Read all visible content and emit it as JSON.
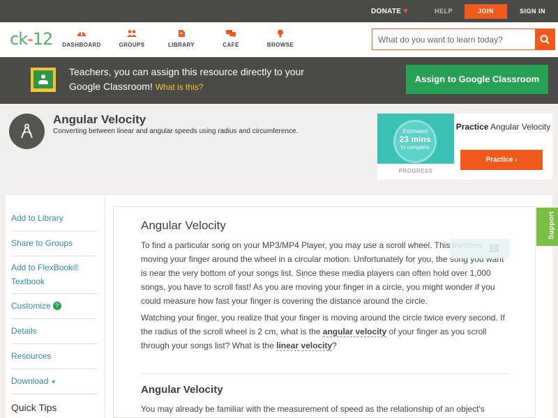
{
  "topbar": {
    "donate": "DONATE",
    "help": "HELP",
    "join": "JOIN",
    "signin": "SIGN IN"
  },
  "nav": {
    "logo": "CK-12",
    "items": [
      {
        "label": "DASHBOARD",
        "icon": "dashboard-icon"
      },
      {
        "label": "GROUPS",
        "icon": "groups-icon"
      },
      {
        "label": "LIBRARY",
        "icon": "library-icon"
      },
      {
        "label": "CAFE",
        "icon": "cafe-icon"
      },
      {
        "label": "BROWSE",
        "icon": "browse-icon"
      }
    ],
    "search_placeholder": "What do you want to learn today?"
  },
  "banner": {
    "text": "Teachers, you can assign this resource directly to your Google Classroom!",
    "link": "What is this?",
    "button": "Assign to Google Classroom"
  },
  "header": {
    "title": "Angular Velocity",
    "subtitle": "Converting between linear and angular speeds using radius and circumference."
  },
  "practice": {
    "estimated": "Estimated",
    "minutes": "23 mins",
    "to_complete": "to complete",
    "progress": "PROGRESS",
    "title_bold": "Practice",
    "title_rest": "Angular Velocity",
    "button": "Practice"
  },
  "sidebar": {
    "items": [
      {
        "label": "Add to Library"
      },
      {
        "label": "Share to Groups"
      },
      {
        "label": "Add to FlexBook® Textbook"
      },
      {
        "label": "Customize"
      },
      {
        "label": "Details"
      },
      {
        "label": "Resources"
      },
      {
        "label": "Download"
      }
    ],
    "quick_tips": "Quick Tips"
  },
  "content": {
    "title": "Angular Velocity",
    "p1": "To find a particular song on your MP3/MP4 Player, you may use a scroll wheel. This involves moving your finger around the wheel in a circular motion. Unfortunately for you, the song you want is near the very bottom of your songs list. Since these media players can often hold over 1,000 songs, you have to scroll fast! As you are moving your finger in a circle, you might wonder if you could measure how fast your finger is covering the distance around the circle.",
    "p2_a": "Watching your finger, you realize that your finger is moving around the circle twice every second. If the radius of the scroll wheel is 2 cm, what is the ",
    "p2_kw1": "angular velocity",
    "p2_b": " of your finger as you scroll through your songs list? What is the ",
    "p2_kw2": "linear velocity",
    "p2_c": "?",
    "section_title": "Angular Velocity",
    "p3": "You may already be familiar with the measurement of speed as the relationship of an object's"
  },
  "support": "Support",
  "colors": {
    "accent": "#f2591d",
    "green": "#27a154",
    "link": "#2f8bb0",
    "dark_bar": "#4a4a47"
  }
}
